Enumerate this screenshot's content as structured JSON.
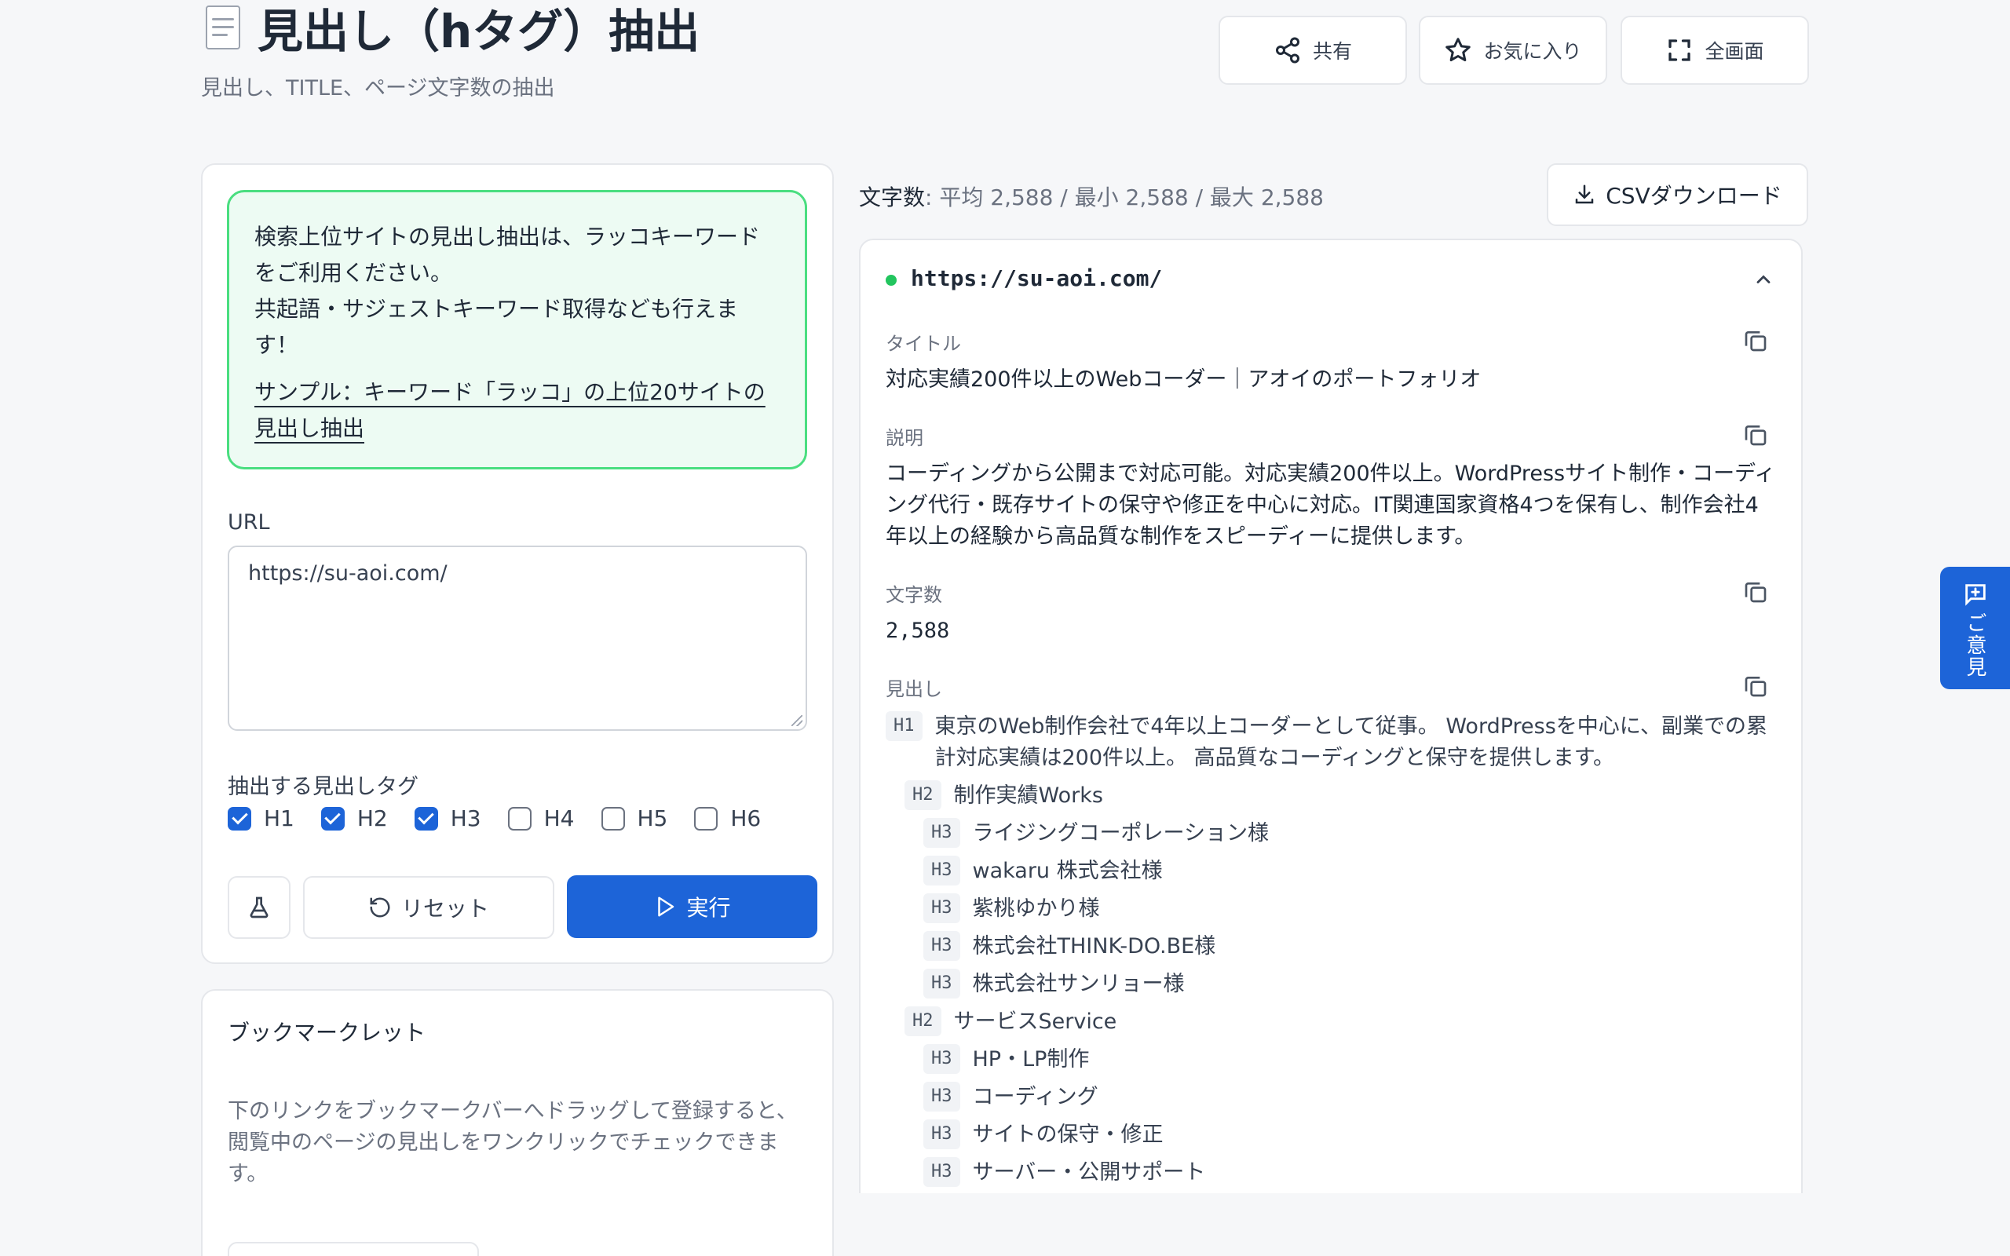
{
  "header": {
    "title": "見出し（hタグ）抽出",
    "subtitle": "見出し、TITLE、ページ文字数の抽出",
    "buttons": {
      "share": "共有",
      "favorite": "お気に入り",
      "fullscreen": "全画面"
    }
  },
  "notice": {
    "line1": "検索上位サイトの見出し抽出は、ラッコキーワードをご利用ください。",
    "line2": "共起語・サジェストキーワード取得なども行えます！",
    "link": "サンプル：キーワード「ラッコ」の上位20サイトの見出し抽出"
  },
  "form": {
    "url_label": "URL",
    "url_value": "https://su-aoi.com/",
    "tags_label": "抽出する見出しタグ",
    "tags": [
      {
        "label": "H1",
        "checked": true
      },
      {
        "label": "H2",
        "checked": true
      },
      {
        "label": "H3",
        "checked": true
      },
      {
        "label": "H4",
        "checked": false
      },
      {
        "label": "H5",
        "checked": false
      },
      {
        "label": "H6",
        "checked": false
      }
    ],
    "reset_label": "リセット",
    "run_label": "実行"
  },
  "bookmarklet": {
    "title": "ブックマークレット",
    "description": "下のリンクをブックマークバーへドラッグして登録すると、閲覧中のページの見出しをワンクリックでチェックできます。"
  },
  "stats": {
    "label": "文字数",
    "value": ": 平均 2,588 / 最小 2,588 / 最大 2,588",
    "csv_label": "CSVダウンロード"
  },
  "result": {
    "url": "https://su-aoi.com/",
    "status_color": "#22c55e",
    "title_label": "タイトル",
    "title_value": "対応実績200件以上のWebコーダー｜アオイのポートフォリオ",
    "desc_label": "説明",
    "desc_value": "コーディングから公開まで対応可能。対応実績200件以上。WordPressサイト制作・コーディング代行・既存サイトの保守や修正を中心に対応。IT関連国家資格4つを保有し、制作会社4年以上の経験から高品質な制作をスピーディーに提供します。",
    "chars_label": "文字数",
    "chars_value": "2,588",
    "headings_label": "見出し",
    "headings": [
      {
        "tag": "H1",
        "text": "東京のWeb制作会社で4年以上コーダーとして従事。 WordPressを中心に、副業での累計対応実績は200件以上。 高品質なコーディングと保守を提供します。"
      },
      {
        "tag": "H2",
        "text": "制作実績Works"
      },
      {
        "tag": "H3",
        "text": "ライジングコーポレーション様"
      },
      {
        "tag": "H3",
        "text": "wakaru 株式会社様"
      },
      {
        "tag": "H3",
        "text": "紫桃ゆかり様"
      },
      {
        "tag": "H3",
        "text": "株式会社THINK-DO.BE様"
      },
      {
        "tag": "H3",
        "text": "株式会社サンリョー様"
      },
      {
        "tag": "H2",
        "text": "サービスService"
      },
      {
        "tag": "H3",
        "text": "HP・LP制作"
      },
      {
        "tag": "H3",
        "text": "コーディング"
      },
      {
        "tag": "H3",
        "text": "サイトの保守・修正"
      },
      {
        "tag": "H3",
        "text": "サーバー・公開サポート"
      }
    ]
  },
  "feedback": {
    "label": "ご意見"
  },
  "colors": {
    "accent": "#1d64d8",
    "notice_border": "#4ade80",
    "notice_bg": "#edfbf3"
  }
}
